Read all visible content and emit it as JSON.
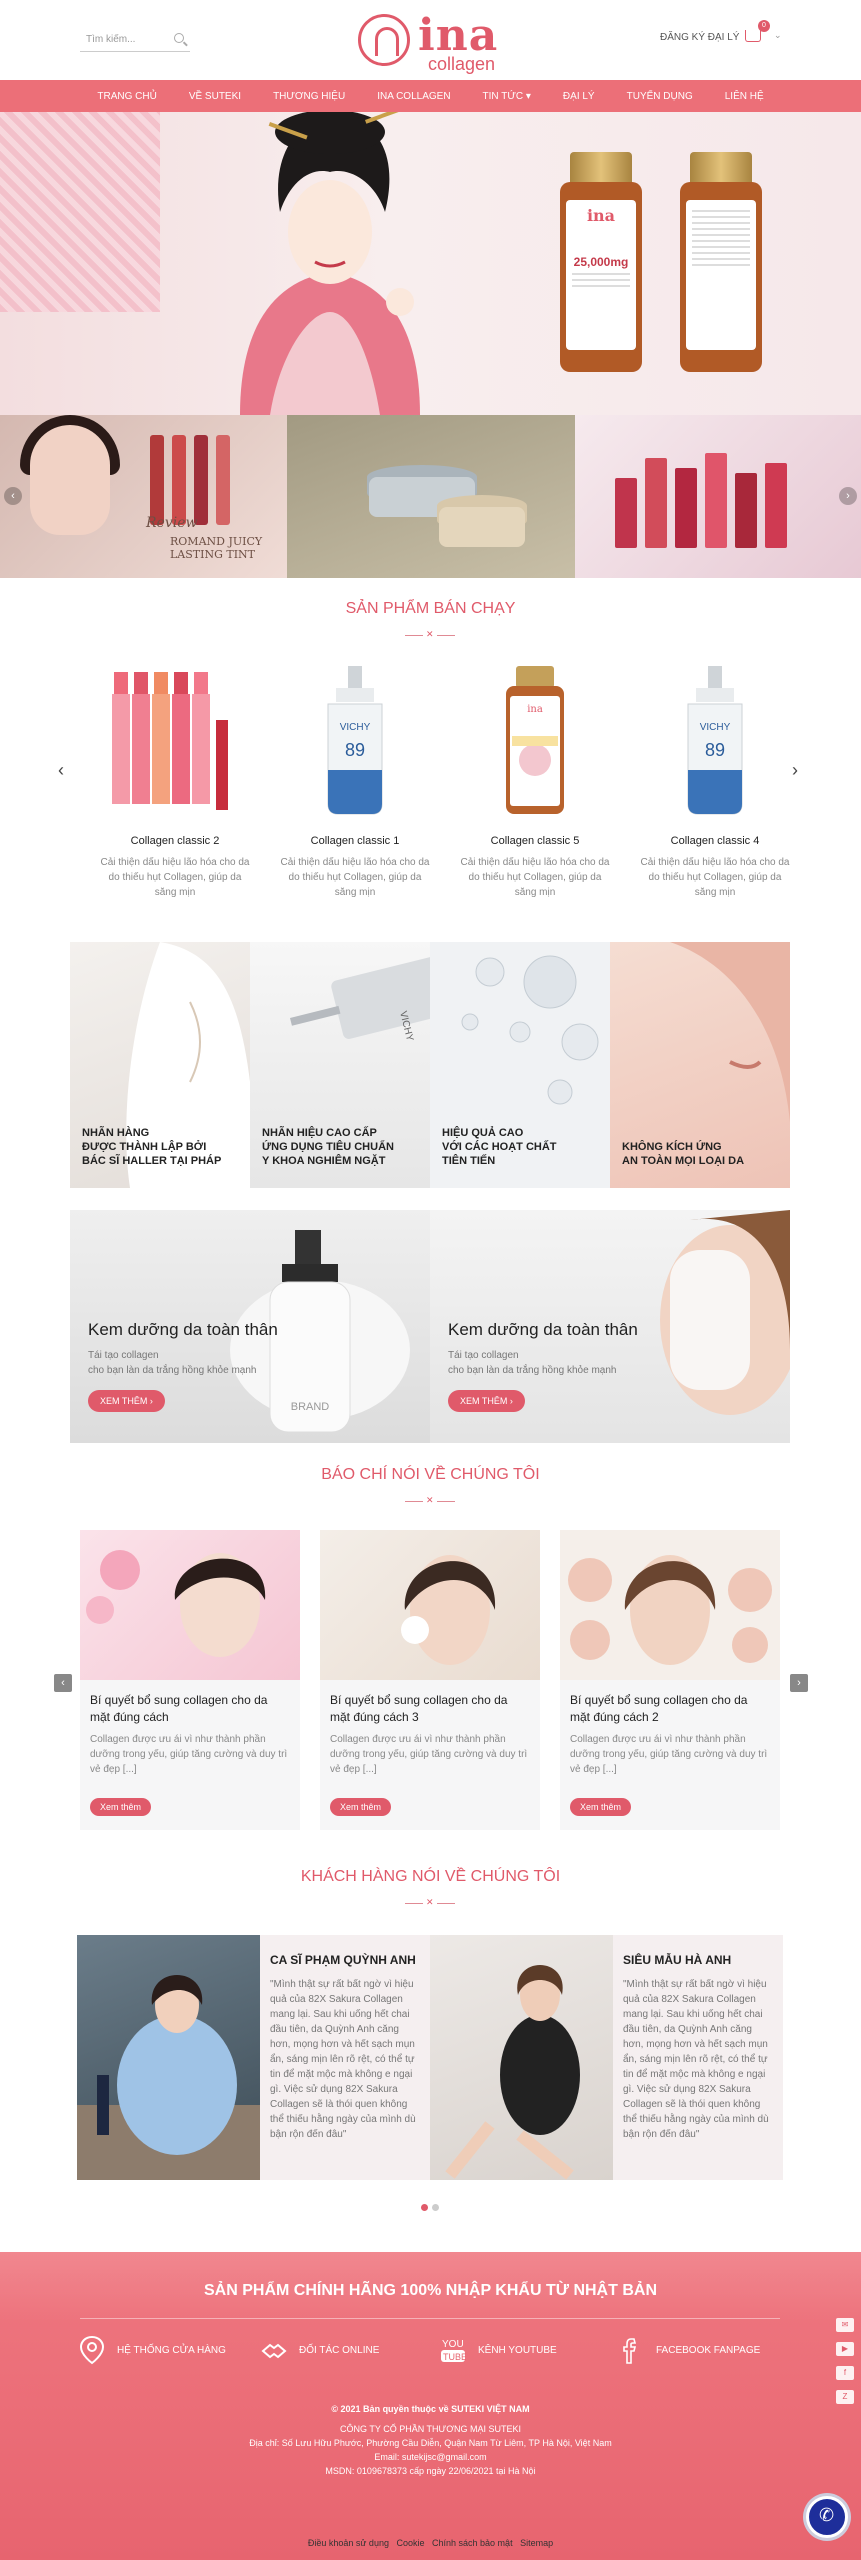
{
  "header": {
    "search_placeholder": "Tìm kiếm...",
    "logo_text": "ina",
    "logo_sub": "collagen",
    "dealer_label": "ĐĂNG KÝ ĐẠI LÝ",
    "cart_count": "0"
  },
  "nav": {
    "items": [
      "TRANG CHỦ",
      "VỀ SUTEKI",
      "THƯƠNG HIỆU",
      "INA COLLAGEN",
      "TIN TỨC ▾",
      "ĐẠI LÝ",
      "TUYỂN DỤNG",
      "LIÊN HỆ"
    ]
  },
  "hero": {
    "bottle_name": "ina",
    "bottle_mg": "25,000mg"
  },
  "banner": {
    "review_caption": "Review",
    "review_product": "ROMAND JUICY LASTING TINT"
  },
  "bestseller": {
    "title": "SẢN PHẨM BÁN CHẠY",
    "products": [
      {
        "name": "Collagen classic 2",
        "desc": "Cải thiện dấu hiệu lão hóa cho da do thiếu hụt Collagen, giúp da săng mịn"
      },
      {
        "name": "Collagen classic 1",
        "desc": "Cải thiện dấu hiệu lão hóa cho da do thiếu hụt Collagen, giúp da săng mịn"
      },
      {
        "name": "Collagen classic 5",
        "desc": "Cải thiện dấu hiệu lão hóa cho da do thiếu hụt Collagen, giúp da săng mịn"
      },
      {
        "name": "Collagen classic 4",
        "desc": "Cải thiện dấu hiệu lão hóa cho da do thiếu hụt Collagen, giúp da săng mịn"
      }
    ]
  },
  "features": [
    {
      "l1": "NHÃN HÀNG",
      "l2": "ĐƯỢC THÀNH LẬP BỞI",
      "l3": "BÁC SĨ HALLER TẠI PHÁP"
    },
    {
      "l1": "NHÃN HIỆU CAO CẤP",
      "l2": "ỨNG DỤNG TIÊU CHUẨN",
      "l3": "Y KHOA NGHIÊM NGẶT"
    },
    {
      "l1": "HIỆU QUẢ CAO",
      "l2": "VỚI CÁC HOẠT CHẤT",
      "l3": "TIÊN TIẾN"
    },
    {
      "l1": "KHÔNG KÍCH ỨNG",
      "l2": "AN TOÀN MỌI LOẠI DA",
      "l3": ""
    }
  ],
  "promos": [
    {
      "title": "Kem dưỡng da toàn thân",
      "l1": "Tái tạo collagen",
      "l2": "cho bạn làn da trắng hồng khỏe mạnh",
      "btn": "XEM THÊM  ›",
      "brand": "BRAND"
    },
    {
      "title": "Kem dưỡng da toàn thân",
      "l1": "Tái tạo collagen",
      "l2": "cho bạn làn da trắng hồng khỏe mạnh",
      "btn": "XEM THÊM  ›"
    }
  ],
  "press": {
    "title": "BÁO CHÍ NÓI VỀ CHÚNG TÔI",
    "cards": [
      {
        "title": "Bí quyết bổ sung collagen cho da mặt đúng cách",
        "desc": "Collagen được ưu ái vì như thành phần dưỡng trong yếu, giúp tăng cường và duy trì vẻ đẹp [...]",
        "btn": "Xem thêm"
      },
      {
        "title": "Bí quyết bổ sung collagen cho da mặt đúng cách 3",
        "desc": "Collagen được ưu ái vì như thành phần dưỡng trong yếu, giúp tăng cường và duy trì vẻ đẹp [...]",
        "btn": "Xem thêm"
      },
      {
        "title": "Bí quyết bổ sung collagen cho da mặt đúng cách 2",
        "desc": "Collagen được ưu ái vì như thành phần dưỡng trong yếu, giúp tăng cường và duy trì vẻ đẹp [...]",
        "btn": "Xem thêm"
      }
    ]
  },
  "testimonials": {
    "title": "KHÁCH HÀNG NÓI VỀ CHÚNG TÔI",
    "items": [
      {
        "name": "CA SĨ PHẠM QUỲNH ANH",
        "quote": "\"Mình thật sự rất bất ngờ vì hiệu quả của 82X Sakura Collagen mang lại. Sau khi uống hết chai đầu tiên, da Quỳnh Anh căng hơn, mọng hơn và hết sạch mụn ẩn, sáng mịn lên rõ rệt, có thể tự tin để mặt mộc mà không e ngại gì. Việc sử dụng 82X Sakura Collagen sẽ là thói quen không thể thiếu hằng ngày của mình dù bận rộn đến đâu\""
      },
      {
        "name": "SIÊU MẪU HÀ ANH",
        "quote": "\"Mình thật sự rất bất ngờ vì hiệu quả của 82X Sakura Collagen mang lại. Sau khi uống hết chai đầu tiên, da Quỳnh Anh căng hơn, mọng hơn và hết sạch mụn ẩn, sáng mịn lên rõ rệt, có thể tự tin để mặt mộc mà không e ngại gì. Việc sử dụng 82X Sakura Collagen sẽ là thói quen không thể thiếu hằng ngày của mình dù bận rộn đến đâu\""
      }
    ]
  },
  "footer": {
    "title": "SẢN PHẨM CHÍNH HÃNG 100% NHẬP KHẨU TỪ NHẬT BẢN",
    "links": [
      "HỆ THỐNG CỬA HÀNG",
      "ĐỐI TÁC ONLINE",
      "KÊNH YOUTUBE",
      "FACEBOOK FANPAGE"
    ],
    "copyright": "© 2021 Bản quyền thuộc về SUTEKI VIỆT NAM",
    "company": "CÔNG TY CỔ PHẦN THƯƠNG MẠI SUTEKI",
    "address": "Địa chỉ: Số Lưu Hữu Phước, Phường Cầu Diễn, Quận Nam Từ Liêm, TP Hà Nội, Việt Nam",
    "email": "Email: sutekijsc@gmail.com",
    "msdn": "MSDN: 0109678373 cấp ngày 22/06/2021 tại Hà Nội",
    "bottom_links": [
      "Điều khoản sử dụng",
      "Cookie",
      "Chính sách bảo mật",
      "Sitemap"
    ]
  },
  "colors": {
    "accent": "#e05a6a",
    "nav": "#ec6f78"
  }
}
